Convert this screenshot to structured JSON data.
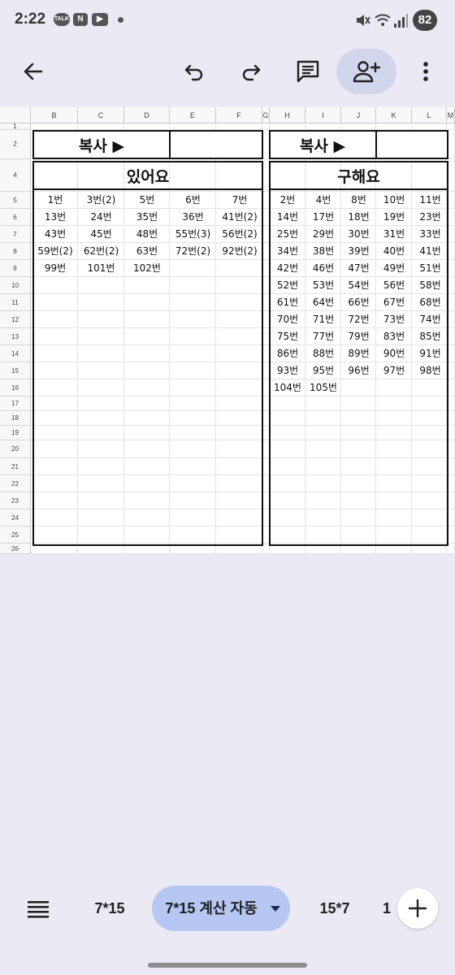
{
  "status": {
    "time": "2:22",
    "apps": [
      "TALK",
      "N",
      "▶"
    ],
    "battery": "82"
  },
  "sheet": {
    "columns": [
      "B",
      "C",
      "D",
      "E",
      "F",
      "G",
      "H",
      "I",
      "J",
      "K",
      "L",
      "M"
    ],
    "rows": [
      "1",
      "2",
      "4",
      "5",
      "6",
      "7",
      "8",
      "9",
      "10",
      "11",
      "12",
      "13",
      "14",
      "15",
      "16",
      "17",
      "18",
      "19",
      "20",
      "21",
      "22",
      "23",
      "24",
      "25",
      "26"
    ],
    "left_copy": "복사 ▶",
    "left_title": "있어요",
    "right_copy": "복사 ▶",
    "right_title": "구해요",
    "left_data": [
      [
        "1번",
        "3번(2)",
        "5번",
        "6번",
        "7번"
      ],
      [
        "13번",
        "24번",
        "35번",
        "36번",
        "41번(2)"
      ],
      [
        "43번",
        "45번",
        "48번",
        "55번(3)",
        "56번(2)"
      ],
      [
        "59번(2)",
        "62번(2)",
        "63번",
        "72번(2)",
        "92번(2)"
      ],
      [
        "99번",
        "101번",
        "102번",
        "",
        ""
      ]
    ],
    "right_data": [
      [
        "2번",
        "4번",
        "8번",
        "10번",
        "11번"
      ],
      [
        "14번",
        "17번",
        "18번",
        "19번",
        "23번"
      ],
      [
        "25번",
        "29번",
        "30번",
        "31번",
        "33번"
      ],
      [
        "34번",
        "38번",
        "39번",
        "40번",
        "41번"
      ],
      [
        "42번",
        "46번",
        "47번",
        "49번",
        "51번"
      ],
      [
        "52번",
        "53번",
        "54번",
        "56번",
        "58번"
      ],
      [
        "61번",
        "64번",
        "66번",
        "67번",
        "68번"
      ],
      [
        "70번",
        "71번",
        "72번",
        "73번",
        "74번"
      ],
      [
        "75번",
        "77번",
        "79번",
        "83번",
        "85번"
      ],
      [
        "86번",
        "88번",
        "89번",
        "90번",
        "91번"
      ],
      [
        "93번",
        "95번",
        "96번",
        "97번",
        "98번"
      ],
      [
        "104번",
        "105번",
        "",
        "",
        ""
      ]
    ]
  },
  "tabs": [
    {
      "label": "7*15",
      "active": false
    },
    {
      "label": "7*15 계산 자동",
      "active": true
    },
    {
      "label": "15*7",
      "active": false
    },
    {
      "label": "1",
      "active": false
    }
  ],
  "icons": {
    "back": "arrow-left-icon",
    "undo": "undo-icon",
    "redo": "redo-icon",
    "comment": "comment-icon",
    "share": "add-person-icon",
    "more": "more-vert-icon",
    "sheets_list": "menu-list-icon",
    "add_sheet": "plus-icon"
  },
  "colors": {
    "background": "#ebe9f3",
    "active_tab": "#b6c7f4",
    "share_button": "#d2d6ec"
  }
}
